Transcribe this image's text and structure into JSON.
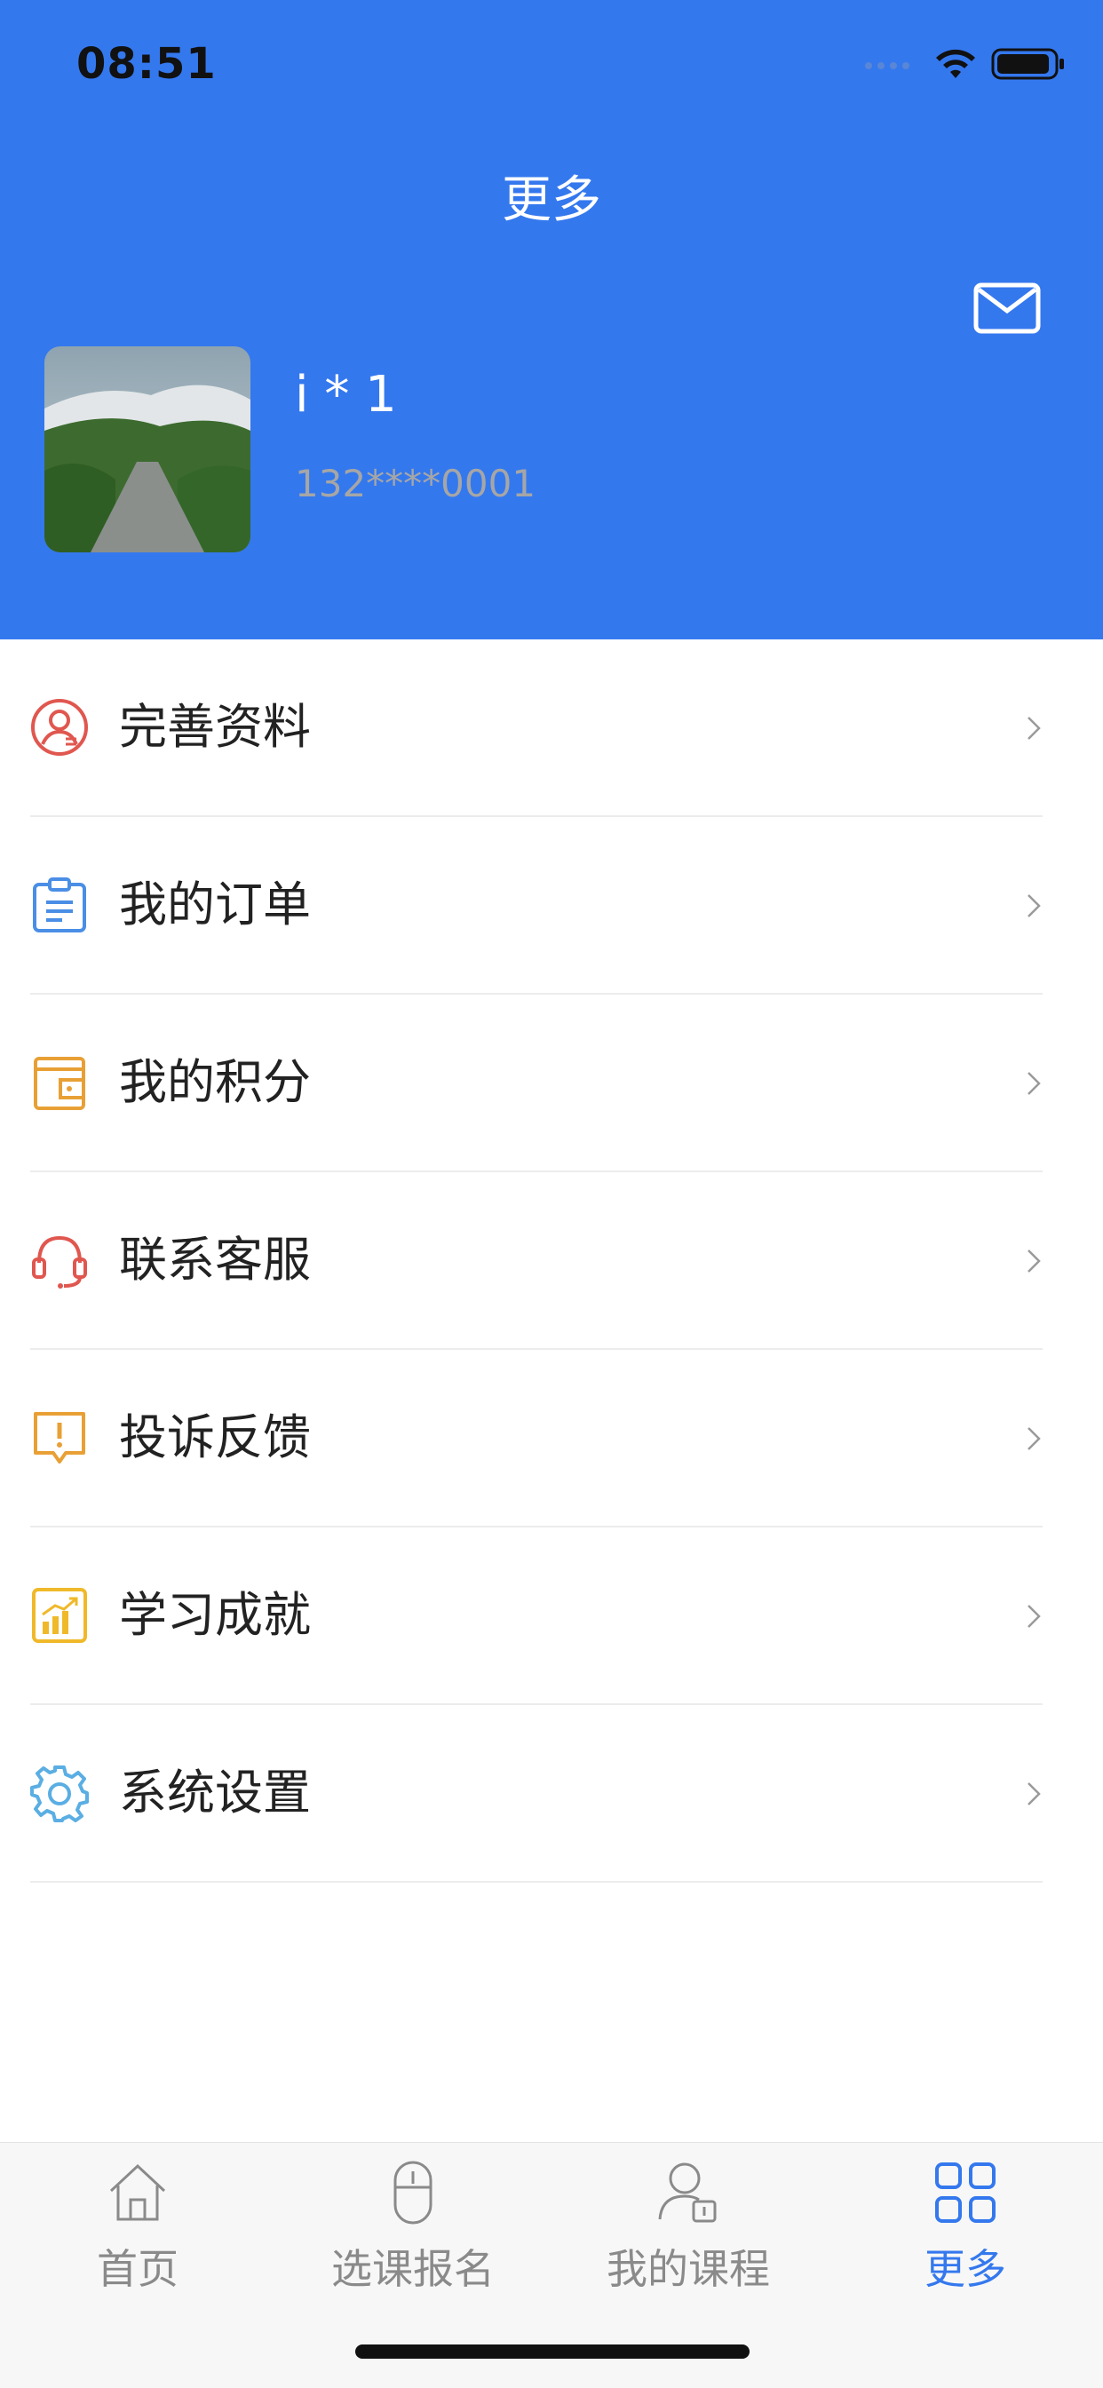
{
  "status_bar": {
    "time": "08:51"
  },
  "header": {
    "title": "更多",
    "user": {
      "name": "i * 1",
      "phone": "132****0001"
    }
  },
  "menu": [
    {
      "label": "完善资料",
      "icon": "user-profile-icon"
    },
    {
      "label": "我的订单",
      "icon": "clipboard-icon"
    },
    {
      "label": "我的积分",
      "icon": "wallet-icon"
    },
    {
      "label": "联系客服",
      "icon": "headset-icon"
    },
    {
      "label": "投诉反馈",
      "icon": "alert-message-icon"
    },
    {
      "label": "学习成就",
      "icon": "chart-icon"
    },
    {
      "label": "系统设置",
      "icon": "gear-icon"
    }
  ],
  "tabs": [
    {
      "label": "首页",
      "icon": "home-icon"
    },
    {
      "label": "选课报名",
      "icon": "mouse-icon"
    },
    {
      "label": "我的课程",
      "icon": "user-course-icon"
    },
    {
      "label": "更多",
      "icon": "grid-icon",
      "active": true
    }
  ],
  "colors": {
    "accent": "#3478ee",
    "tab_inactive": "#8a8a8a",
    "phone_text": "#a6a6a6"
  }
}
